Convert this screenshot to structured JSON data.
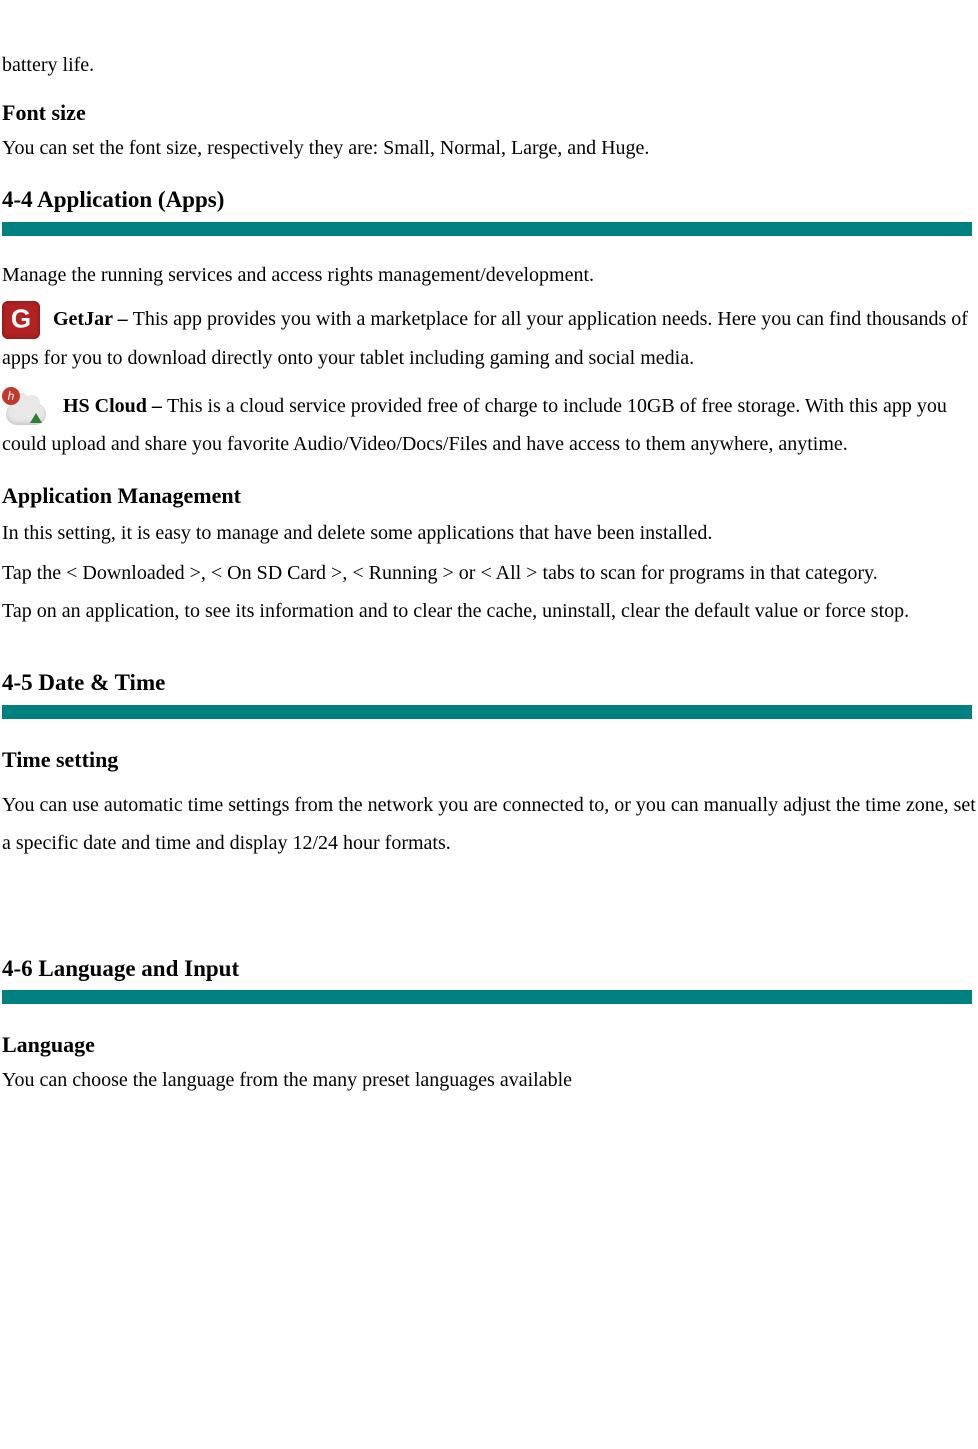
{
  "intro": {
    "battery_fragment": "battery life."
  },
  "font_size": {
    "heading": "Font size",
    "text": "You can set the font size, respectively they are: Small, Normal, Large, and Huge."
  },
  "section_4_4": {
    "title": "4-4 Application (Apps)",
    "intro": "Manage the running services and access rights management/development.",
    "getjar_label": "GetJar – ",
    "getjar_text": "This app provides you with a marketplace for all your application needs.    Here you can find thousands of apps for you to download directly onto your tablet including gaming and social media.",
    "hscloud_label": "HS Cloud – ",
    "hscloud_text": "This is a cloud service provided free of charge to include 10GB of free storage.  With this app you could upload and share you favorite Audio/Video/Docs/Files and have access to them anywhere, anytime.",
    "app_mgmt_heading": "Application Management",
    "app_mgmt_p1": "In this setting, it is easy to manage and delete some applications that have been installed.",
    "app_mgmt_p2": "Tap the < Downloaded >, < On SD Card >, < Running > or < All > tabs to scan for programs in that category.",
    "app_mgmt_p3": "Tap on an application, to see its information and to clear the cache, uninstall, clear the default value or force stop."
  },
  "section_4_5": {
    "title": "4-5 Date & Time",
    "time_heading": "Time setting",
    "time_text": "You can use automatic time settings from the network you are connected to, or you can manually adjust the time zone, set a specific date and time and display 12/24 hour formats."
  },
  "section_4_6": {
    "title": "4-6 Language and Input",
    "lang_heading": "Language",
    "lang_text": "You can choose the language from the many preset languages available"
  }
}
